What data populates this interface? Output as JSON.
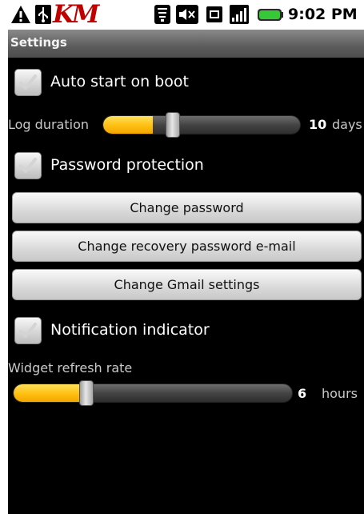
{
  "status_bar": {
    "carrier_logo": "KM",
    "icons": [
      "warning-icon",
      "usb-icon",
      "carrier-logo",
      "wifi-icon",
      "mute-icon",
      "sim-icon",
      "signal-icon",
      "battery-icon"
    ],
    "time": "9:02 PM"
  },
  "title": "Settings",
  "colors": {
    "accent_fill": "#ffbe10",
    "background": "#000000"
  },
  "settings": {
    "auto_start": {
      "label": "Auto start on boot",
      "checked": true
    },
    "log_duration": {
      "label": "Log duration",
      "value": "10",
      "unit": "days",
      "fill_fraction": 0.25
    },
    "password_protection": {
      "label": "Password protection",
      "checked": true
    },
    "buttons": {
      "change_password": "Change password",
      "change_recovery_email": "Change recovery password e-mail",
      "change_gmail": "Change Gmail settings"
    },
    "notification_indicator": {
      "label": "Notification indicator",
      "checked": true
    },
    "widget_refresh": {
      "label": "Widget refresh rate",
      "value": "6",
      "unit": "hours",
      "fill_fraction": 0.25
    }
  }
}
